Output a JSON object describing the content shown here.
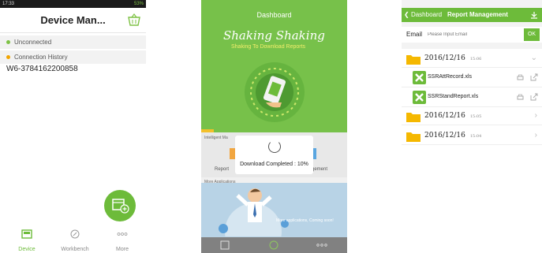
{
  "screen1": {
    "status": {
      "time": "17:33",
      "battery": "53%"
    },
    "title": "Device Man...",
    "groups": [
      {
        "label": "Unconnected",
        "color": "#7ec245"
      },
      {
        "label": "Connection History",
        "color": "#f2a500"
      }
    ],
    "device": "W6-3784162200858",
    "tabs": [
      {
        "label": "Device",
        "icon": "device-icon",
        "active": true
      },
      {
        "label": "Workbench",
        "icon": "workbench-icon",
        "active": false
      },
      {
        "label": "More",
        "icon": "more-icon",
        "active": false
      }
    ]
  },
  "screen2": {
    "title": "Dashboard",
    "banner_title": "Shaking Shaking",
    "banner_subtitle": "Shaking To Download Reports",
    "section1": "Intelligent Ma",
    "report_left": "Report",
    "report_right": "gement",
    "section2": "More Applications",
    "coming": "More applications, Coming soon!",
    "dialog_text": "Download Completed : 10%",
    "progress": 0.1
  },
  "screen3": {
    "back_label": "Dashboard",
    "title": "Report Management",
    "email_label": "Email",
    "email_placeholder": "Please Input Email",
    "ok_label": "OK",
    "folders": [
      {
        "date": "2016/12/16",
        "time": "15:06",
        "expanded": true,
        "files": [
          {
            "name": "SSRAttRecord.xls"
          },
          {
            "name": "SSRStandReport.xls"
          }
        ]
      },
      {
        "date": "2016/12/16",
        "time": "15:05",
        "expanded": false
      },
      {
        "date": "2016/12/16",
        "time": "15:04",
        "expanded": false
      }
    ],
    "colors": {
      "accent": "#6dbb3a",
      "folder": "#f5b800"
    }
  }
}
